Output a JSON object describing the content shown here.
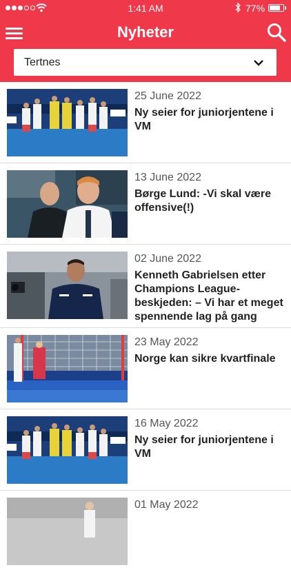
{
  "status_bar": {
    "time": "1:41 AM",
    "battery": "77%",
    "battery_level": 0.77
  },
  "header": {
    "title": "Nyheter",
    "menu_icon": "hamburger-menu-icon",
    "search_icon": "search-icon"
  },
  "filter": {
    "selected": "Tertnes",
    "icon": "chevron-down-icon"
  },
  "colors": {
    "brand": "#f0384b",
    "text": "#222222",
    "date": "#555555",
    "divider": "#dcdcdc"
  },
  "articles": [
    {
      "date": "25 June 2022",
      "title": "Ny seier for juniorjentene i VM"
    },
    {
      "date": "13 June 2022",
      "title": "Børge Lund: -Vi skal være offensive(!)"
    },
    {
      "date": "02 June 2022",
      "title": "Kenneth Gabrielsen etter Champions League-beskjeden: – Vi har et meget spennende lag på gang"
    },
    {
      "date": "23 May 2022",
      "title": "Norge kan sikre kvartfinale"
    },
    {
      "date": "16 May 2022",
      "title": "Ny seier for juniorjentene i VM"
    },
    {
      "date": "01 May 2022",
      "title": ""
    }
  ]
}
